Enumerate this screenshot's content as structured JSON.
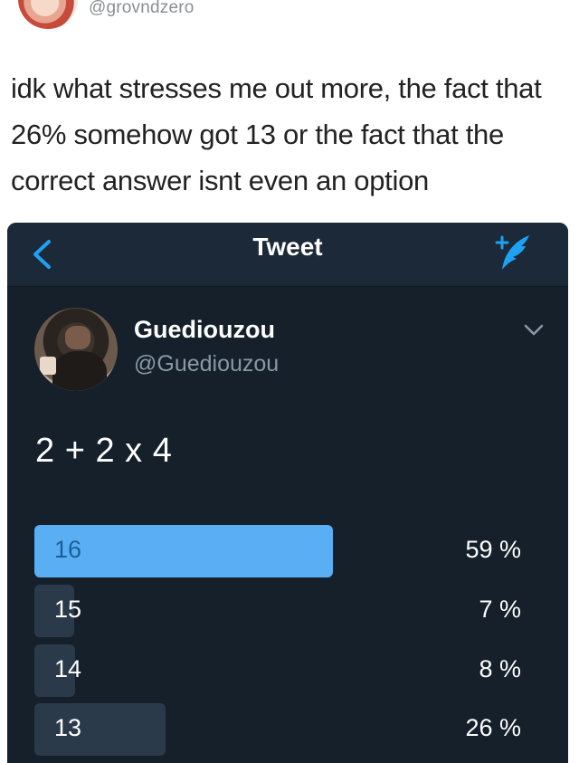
{
  "outer_post": {
    "handle": "@grovndzero",
    "caption": "idk what stresses me out more, the fact that 26% somehow got 13 or the fact that the correct answer isnt even an option"
  },
  "embedded_screen": {
    "nav": {
      "title": "Tweet",
      "back_icon": "chevron-left-icon",
      "compose_icon": "compose-tweet-icon"
    },
    "tweet": {
      "display_name": "Guediouzou",
      "handle": "@Guediouzou",
      "text": "2 + 2 x 4"
    },
    "poll": {
      "options": [
        {
          "label": "16",
          "percent_text": "59 %",
          "percent": 59,
          "leading": true
        },
        {
          "label": "15",
          "percent_text": "7 %",
          "percent": 7,
          "leading": false
        },
        {
          "label": "14",
          "percent_text": "8 %",
          "percent": 8,
          "leading": false
        },
        {
          "label": "13",
          "percent_text": "26 %",
          "percent": 26,
          "leading": false
        }
      ]
    },
    "colors": {
      "background": "#15202b",
      "nav": "#1c2938",
      "accent": "#1da1f2",
      "leading_bar": "#5aaef3",
      "bar": "#2b3a4b"
    }
  }
}
